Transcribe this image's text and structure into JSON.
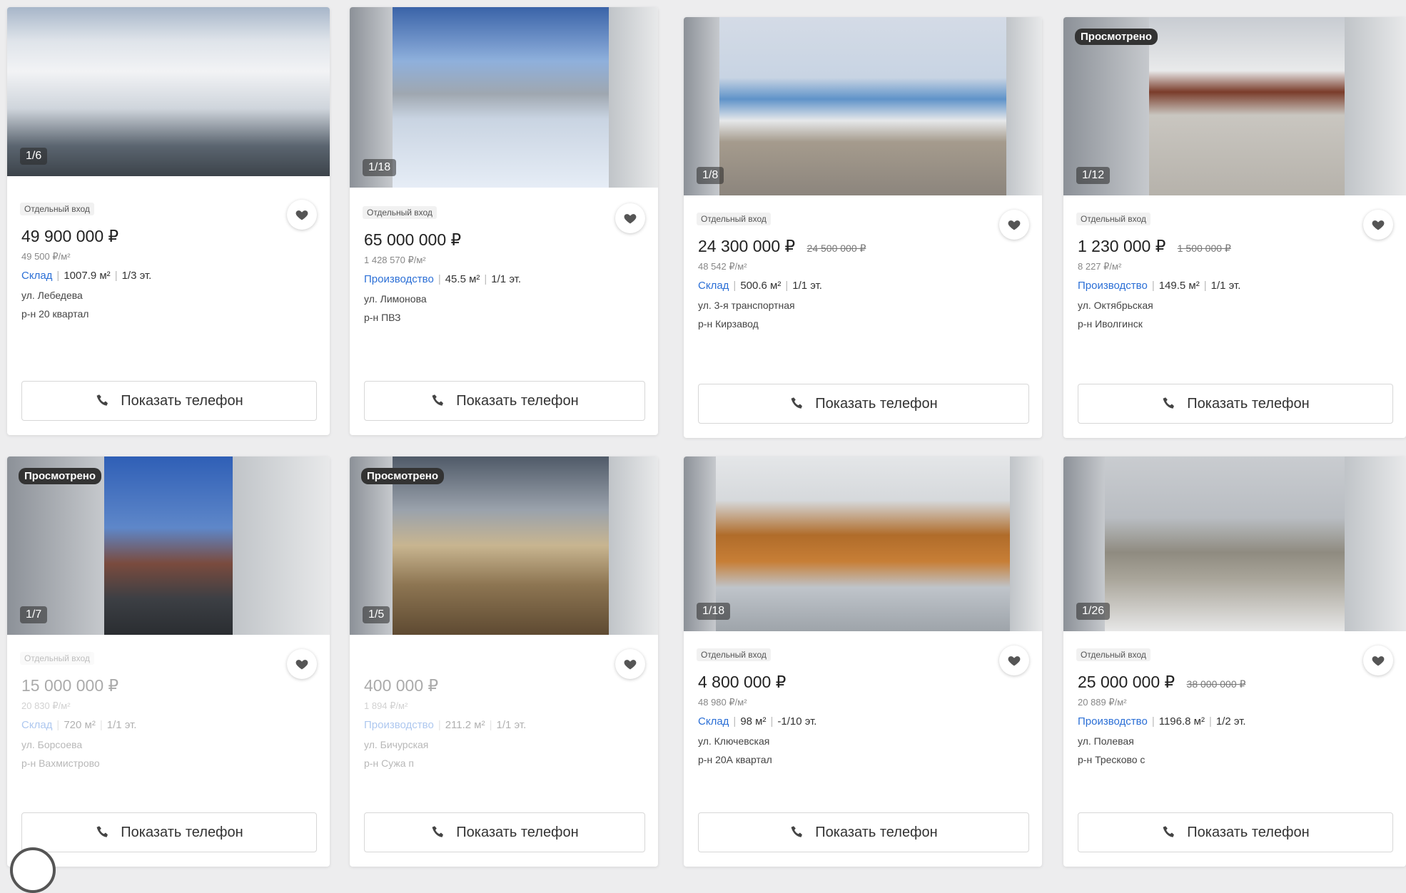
{
  "phone_label": "Показать телефон",
  "cards": [
    {
      "tag": "Отдельный вход",
      "price": "49 900 000 ₽",
      "old_price": "",
      "per_sqm": "49 500 ₽/м²",
      "kind": "Склад",
      "area": "1007.9 м²",
      "floor": "1/3 эт.",
      "street": "ул. Лебедева",
      "district": "р-н 20 квартал",
      "counter": "1/6",
      "viewed": ""
    },
    {
      "tag": "Отдельный вход",
      "price": "65 000 000 ₽",
      "old_price": "",
      "per_sqm": "1 428 570 ₽/м²",
      "kind": "Производство",
      "area": "45.5 м²",
      "floor": "1/1 эт.",
      "street": "ул. Лимонова",
      "district": "р-н ПВЗ",
      "counter": "1/18",
      "viewed": ""
    },
    {
      "tag": "Отдельный вход",
      "price": "24 300 000 ₽",
      "old_price": "24 500 000 ₽",
      "per_sqm": "48 542 ₽/м²",
      "kind": "Склад",
      "area": "500.6 м²",
      "floor": "1/1 эт.",
      "street": "ул. 3-я транспортная",
      "district": "р-н Кирзавод",
      "counter": "1/8",
      "viewed": ""
    },
    {
      "tag": "Отдельный вход",
      "price": "1 230 000 ₽",
      "old_price": "1 500 000 ₽",
      "per_sqm": "8 227 ₽/м²",
      "kind": "Производство",
      "area": "149.5 м²",
      "floor": "1/1 эт.",
      "street": "ул. Октябрьская",
      "district": "р-н Иволгинск",
      "counter": "1/12",
      "viewed": "Просмотрено"
    },
    {
      "tag": "Отдельный вход",
      "price": "15 000 000 ₽",
      "old_price": "",
      "per_sqm": "20 830 ₽/м²",
      "kind": "Склад",
      "area": "720 м²",
      "floor": "1/1 эт.",
      "street": "ул. Борсоева",
      "district": "р-н Вахмистрово",
      "counter": "1/7",
      "viewed": "Просмотрено"
    },
    {
      "tag": "",
      "price": "400 000 ₽",
      "old_price": "",
      "per_sqm": "1 894 ₽/м²",
      "kind": "Производство",
      "area": "211.2 м²",
      "floor": "1/1 эт.",
      "street": "ул. Бичурская",
      "district": "р-н Сужа п",
      "counter": "1/5",
      "viewed": "Просмотрено"
    },
    {
      "tag": "Отдельный вход",
      "price": "4 800 000 ₽",
      "old_price": "",
      "per_sqm": "48 980 ₽/м²",
      "kind": "Склад",
      "area": "98 м²",
      "floor": "-1/10 эт.",
      "street": "ул. Ключевская",
      "district": "р-н 20А квартал",
      "counter": "1/18",
      "viewed": ""
    },
    {
      "tag": "Отдельный вход",
      "price": "25 000 000 ₽",
      "old_price": "38 000 000 ₽",
      "per_sqm": "20 889 ₽/м²",
      "kind": "Производство",
      "area": "1196.8 м²",
      "floor": "1/2 эт.",
      "street": "ул. Полевая",
      "district": "р-н Тресково с",
      "counter": "1/26",
      "viewed": ""
    }
  ],
  "colors": {
    "link": "#2b6fd6",
    "page_bg": "#ededee"
  },
  "icons": [
    "heart-icon",
    "phone-icon"
  ]
}
